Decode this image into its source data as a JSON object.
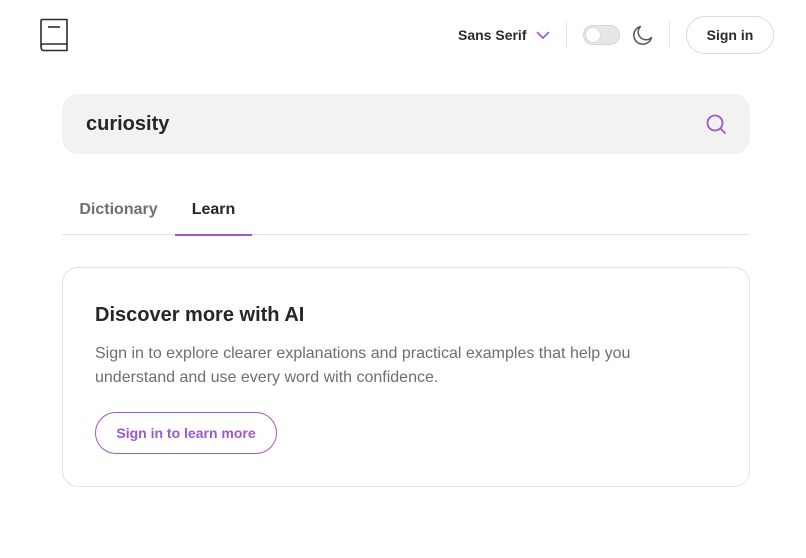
{
  "header": {
    "logo_icon": "book-icon",
    "font_select": {
      "value": "Sans Serif",
      "icon": "chevron-down-icon"
    },
    "theme_toggle": {
      "state": "off"
    },
    "dark_mode_icon": "moon-icon",
    "signin_label": "Sign in"
  },
  "search": {
    "value": "curiosity",
    "icon": "search-icon"
  },
  "tabs": [
    {
      "label": "Dictionary",
      "active": false
    },
    {
      "label": "Learn",
      "active": true
    }
  ],
  "card": {
    "title": "Discover more with AI",
    "description": "Sign in to explore clearer explanations and practical examples that help you understand and use every word with confidence.",
    "button_label": "Sign in to learn more"
  },
  "colors": {
    "accent": "#9b59d0",
    "search_bg": "#f2f2f2",
    "border": "#e2e2e2"
  }
}
